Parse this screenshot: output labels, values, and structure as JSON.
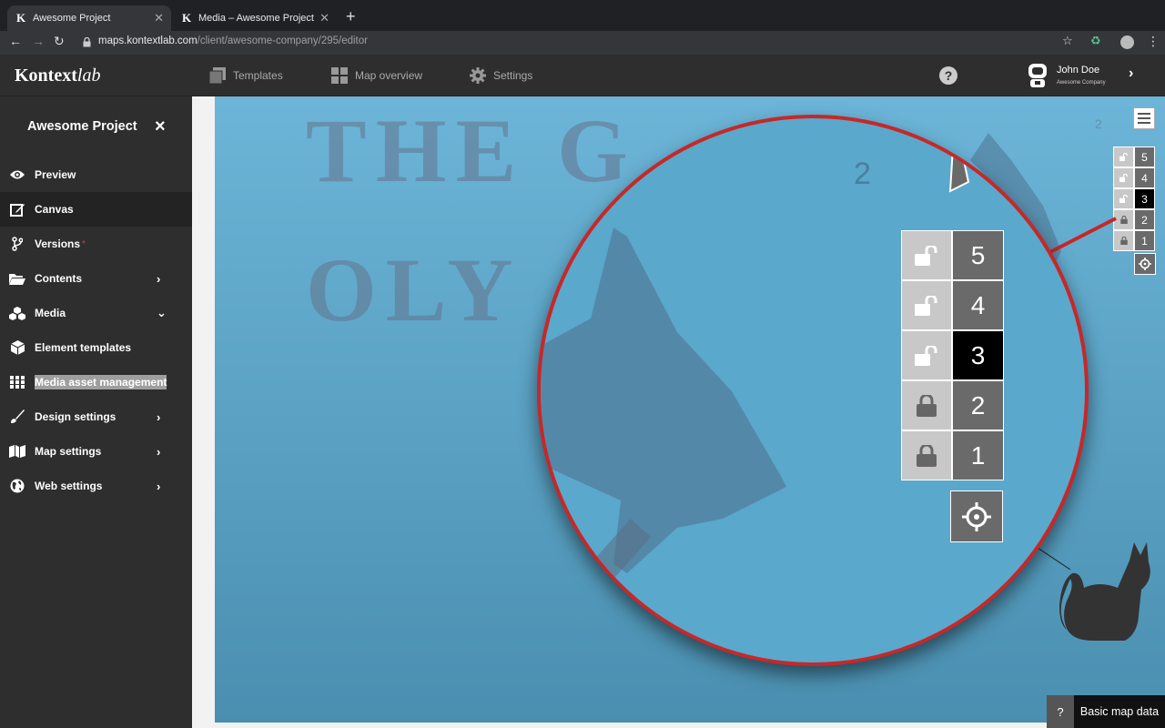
{
  "browser": {
    "tabs": [
      {
        "icon": "K",
        "title": "Awesome Project"
      },
      {
        "icon": "K",
        "title": "Media – Awesome Project"
      }
    ],
    "url_host": "maps.kontextlab.com",
    "url_path": "/client/awesome-company/295/editor"
  },
  "header": {
    "logo_main": "Kontext",
    "logo_italic": "lab",
    "nav": [
      "Templates",
      "Map overview",
      "Settings"
    ],
    "help": "?",
    "user_name": "John Doe",
    "user_company": "Awesome Company"
  },
  "sidebar": {
    "project_title": "Awesome Project",
    "items": [
      {
        "label": "Preview",
        "icon": "eye-icon"
      },
      {
        "label": "Canvas",
        "icon": "edit-icon"
      },
      {
        "label": "Versions",
        "icon": "branch-icon",
        "dot": "*"
      },
      {
        "label": "Contents",
        "icon": "folder-icon"
      },
      {
        "label": "Media",
        "icon": "cubes-icon"
      },
      {
        "label": "Element templates",
        "icon": "cube-icon"
      },
      {
        "label": "Media asset management",
        "icon": "grid-icon"
      },
      {
        "label": "Design settings",
        "icon": "brush-icon"
      },
      {
        "label": "Map settings",
        "icon": "map-icon"
      },
      {
        "label": "Web settings",
        "icon": "globe-icon"
      }
    ]
  },
  "canvas": {
    "title_line1": "THE G",
    "title_line2": "OLY",
    "level_label": "2",
    "layers": [
      {
        "num": "5",
        "locked": false,
        "active": false
      },
      {
        "num": "4",
        "locked": false,
        "active": false
      },
      {
        "num": "3",
        "locked": false,
        "active": true
      },
      {
        "num": "2",
        "locked": true,
        "active": false
      },
      {
        "num": "1",
        "locked": true,
        "active": false
      }
    ]
  },
  "map_data": {
    "help": "?",
    "label": "Basic map data"
  },
  "colors": {
    "accent_red": "#c62828",
    "sea": "#6cb5d8"
  }
}
